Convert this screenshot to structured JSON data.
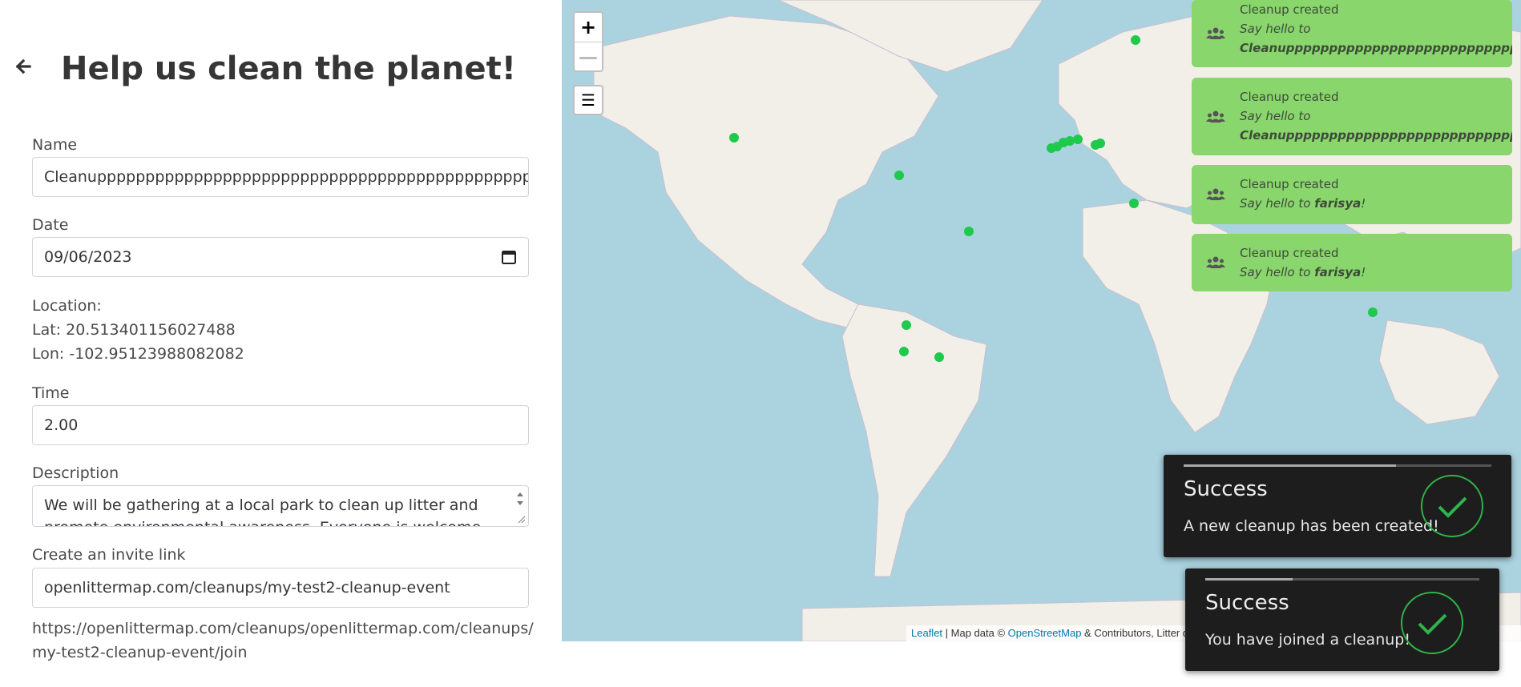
{
  "page": {
    "title": "Help us clean the planet!"
  },
  "form": {
    "name_label": "Name",
    "name_value": "Cleanuppppppppppppppppppppppppppppppppppppppppppppppppppp",
    "date_label": "Date",
    "date_value": "09/06/2023",
    "location_label": "Location:",
    "lat_text": "Lat: 20.513401156027488",
    "lon_text": "Lon: -102.95123988082082",
    "time_label": "Time",
    "time_value": "2.00",
    "description_label": "Description",
    "description_value": "We will be gathering at a local park to clean up litter and promote environmental awareness. Everyone is welcome to join!",
    "invite_label": "Create an invite link",
    "invite_value": "openlittermap.com/cleanups/my-test2-cleanup-event",
    "invite_full_link": "https://openlittermap.com/cleanups/openlittermap.com/cleanups/my-test2-cleanup-event/join"
  },
  "map": {
    "zoom_in": "+",
    "zoom_out": "—",
    "menu_glyph": "☰",
    "attribution": {
      "leaflet": "Leaflet",
      "separator": " | Map data © ",
      "osm": "OpenStreetMap",
      "rest": " & Contributors, Litter data © OpenLitterMap & Contributors, Imagery © MapBox"
    },
    "marker_color": "#1ec94c"
  },
  "notifications": [
    {
      "title": "Cleanup created",
      "say": "Say hello to ",
      "name": "Cleanupppppppppppppppppppppppppppppppppppppppppppppppppp",
      "suffix": "!"
    },
    {
      "title": "Cleanup created",
      "say": "Say hello to ",
      "name": "Cleanupppppppppppppppppppppppppppppppppppppppppppppppppp",
      "suffix": "!"
    },
    {
      "title": "Cleanup created",
      "say": "Say hello to ",
      "name": "farisya",
      "suffix": "!"
    },
    {
      "title": "Cleanup created",
      "say": "Say hello to ",
      "name": "farisya",
      "suffix": "!"
    }
  ],
  "toasts": [
    {
      "title": "Success",
      "message": "A new cleanup has been created!",
      "progress": 0.69
    },
    {
      "title": "Success",
      "message": "You have joined a cleanup!",
      "progress": 0.32
    }
  ],
  "colors": {
    "notification_bg": "#88d66c",
    "toast_bg": "#1d1d1d",
    "check_green": "#2fb34a",
    "sea": "#aad3df",
    "land": "#f2efe9"
  }
}
